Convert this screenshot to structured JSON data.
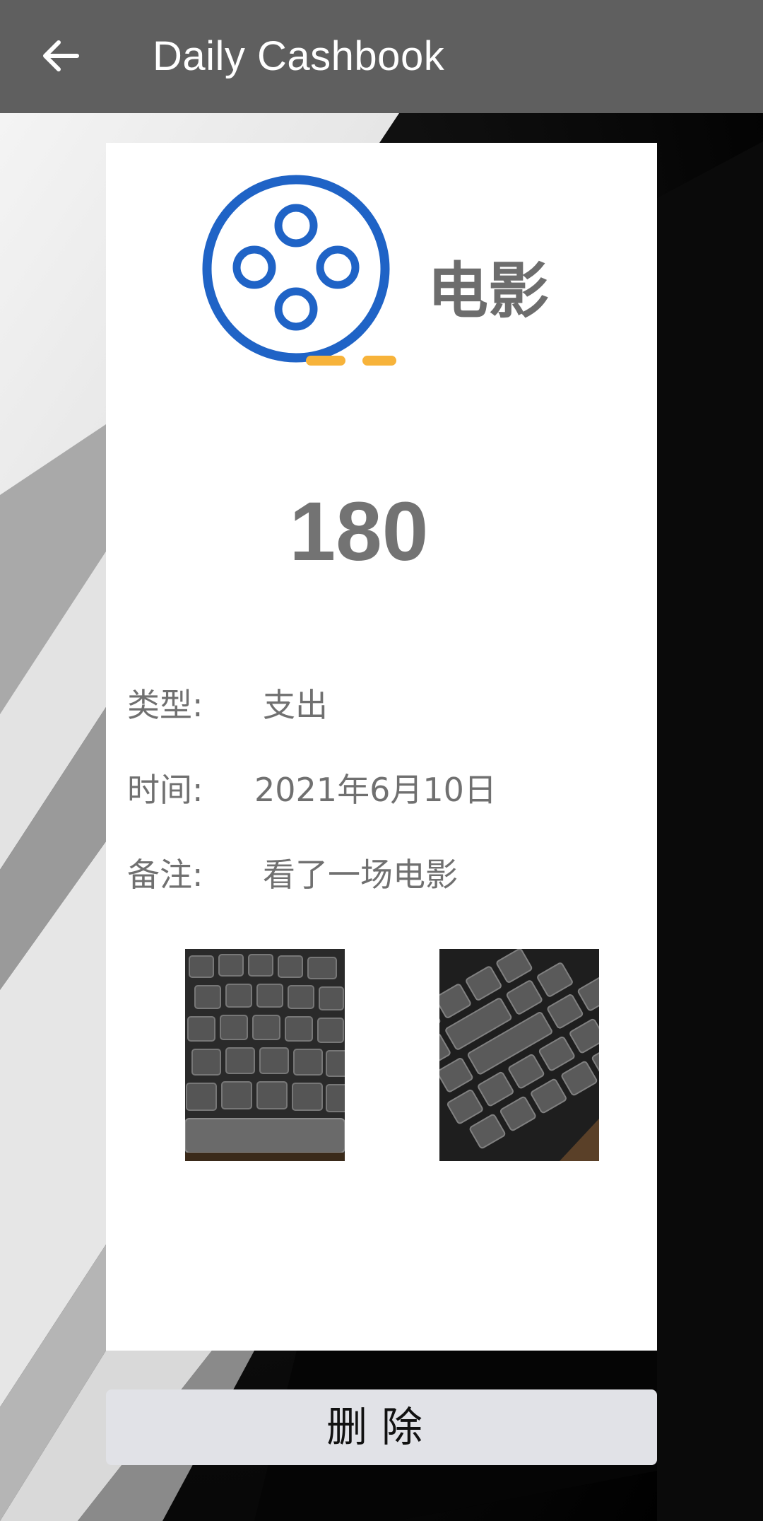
{
  "appbar": {
    "title": "Daily Cashbook",
    "back_icon": "arrow-left-icon"
  },
  "record": {
    "category_icon": "film-reel-icon",
    "category": "电影",
    "amount": "180",
    "fields": [
      {
        "label": "类型:",
        "value": "支出"
      },
      {
        "label": "时间:",
        "value": "2021年6月10日"
      },
      {
        "label": "备注:",
        "value": "看了一场电影"
      }
    ],
    "photos": [
      "keyboard-photo",
      "keyboard-photo"
    ]
  },
  "actions": {
    "delete_label": "删除"
  },
  "colors": {
    "appbar": "#5f5f5f",
    "icon_blue": "#1f63c6",
    "icon_accent": "#f7b33a",
    "text_gray": "#707070",
    "button_bg": "#e1e2e7"
  }
}
